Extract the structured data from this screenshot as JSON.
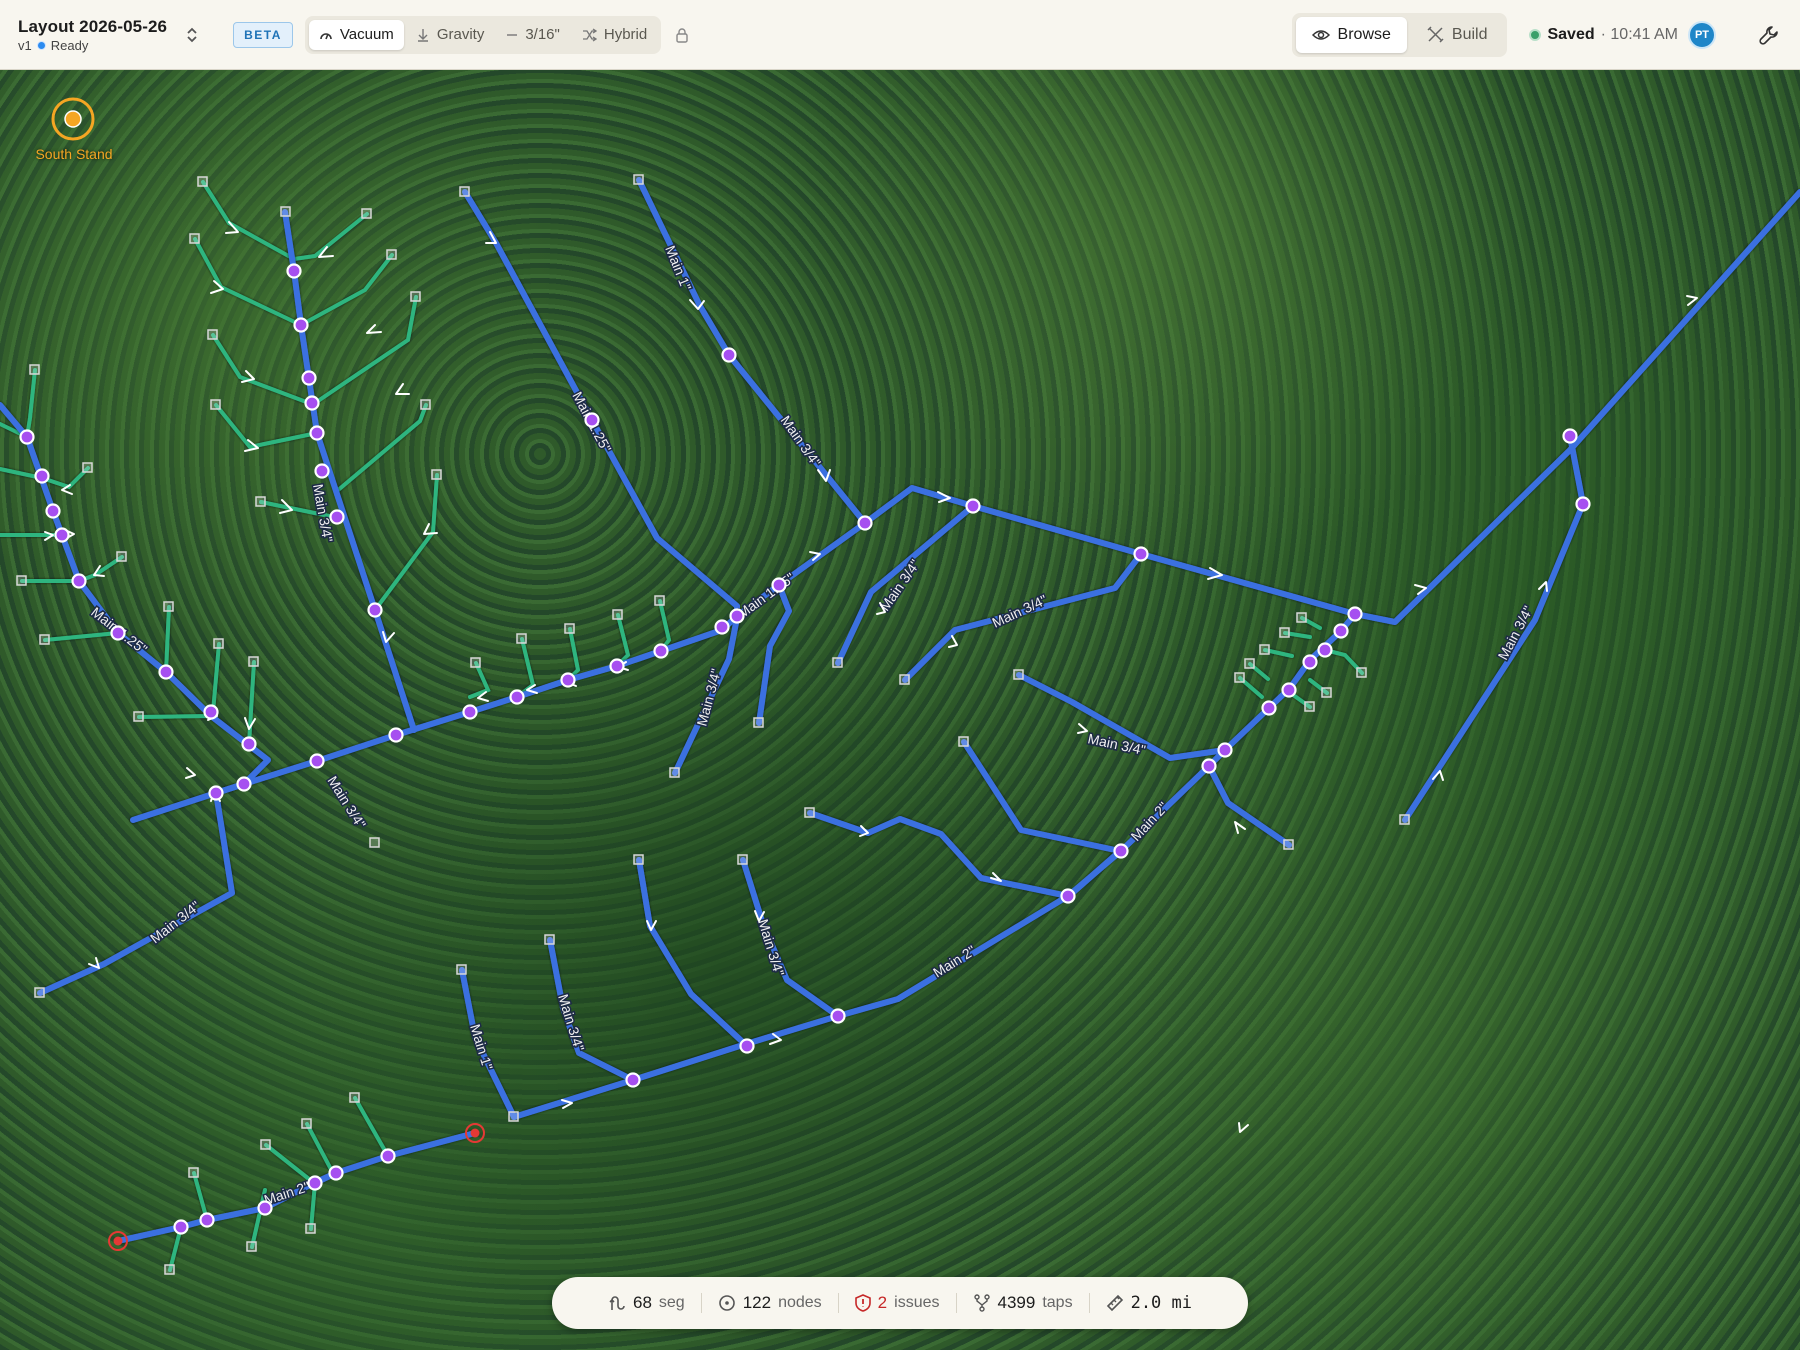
{
  "header": {
    "layout_title": "Layout 2026-05-26",
    "version": "v1",
    "status": "Ready",
    "beta_label": "BETA",
    "modes": [
      {
        "label": "Vacuum",
        "icon": "vacuum-icon",
        "active": true
      },
      {
        "label": "Gravity",
        "icon": "gravity-arrow-icon",
        "active": false
      },
      {
        "label": "3/16\"",
        "icon": "tubing-dash-icon",
        "active": false
      },
      {
        "label": "Hybrid",
        "icon": "shuffle-icon",
        "active": false
      }
    ],
    "view_modes": [
      {
        "label": "Browse",
        "icon": "eye-icon",
        "active": true
      },
      {
        "label": "Build",
        "icon": "build-tools-icon",
        "active": false
      }
    ],
    "saved_label": "Saved",
    "saved_time": "· 10:41 AM",
    "avatar_initials": "PT"
  },
  "map": {
    "stand_label": "South Stand",
    "line_labels": [
      "Main 1.25\"",
      "Main 1\"",
      "Main 3/4\"",
      "Main 3/4\"",
      "Main 3/4\"",
      "Main 3/4\"",
      "Main 2\"",
      "Main 2\"",
      "Main 1\"",
      "Main 3/4\"",
      "Main 3/4\"",
      "Main 1.25\"",
      "Main 3/4\"",
      "Main 3/4\"",
      "Main 3/4\"",
      "Main 2\"",
      "Main 3/4\"",
      "Main 1.25\"",
      "Main 3/4\""
    ],
    "colors": {
      "mainline": "#3b6fe0",
      "lateral": "#2fb57f",
      "node": "#a64ff0",
      "warning": "#e53935",
      "stand": "#f5a623"
    }
  },
  "stats": {
    "segments": "68",
    "segments_unit": "seg",
    "nodes": "122",
    "nodes_unit": "nodes",
    "issues": "2",
    "issues_unit": "issues",
    "taps": "4399",
    "taps_unit": "taps",
    "distance": "2.0 mi"
  }
}
